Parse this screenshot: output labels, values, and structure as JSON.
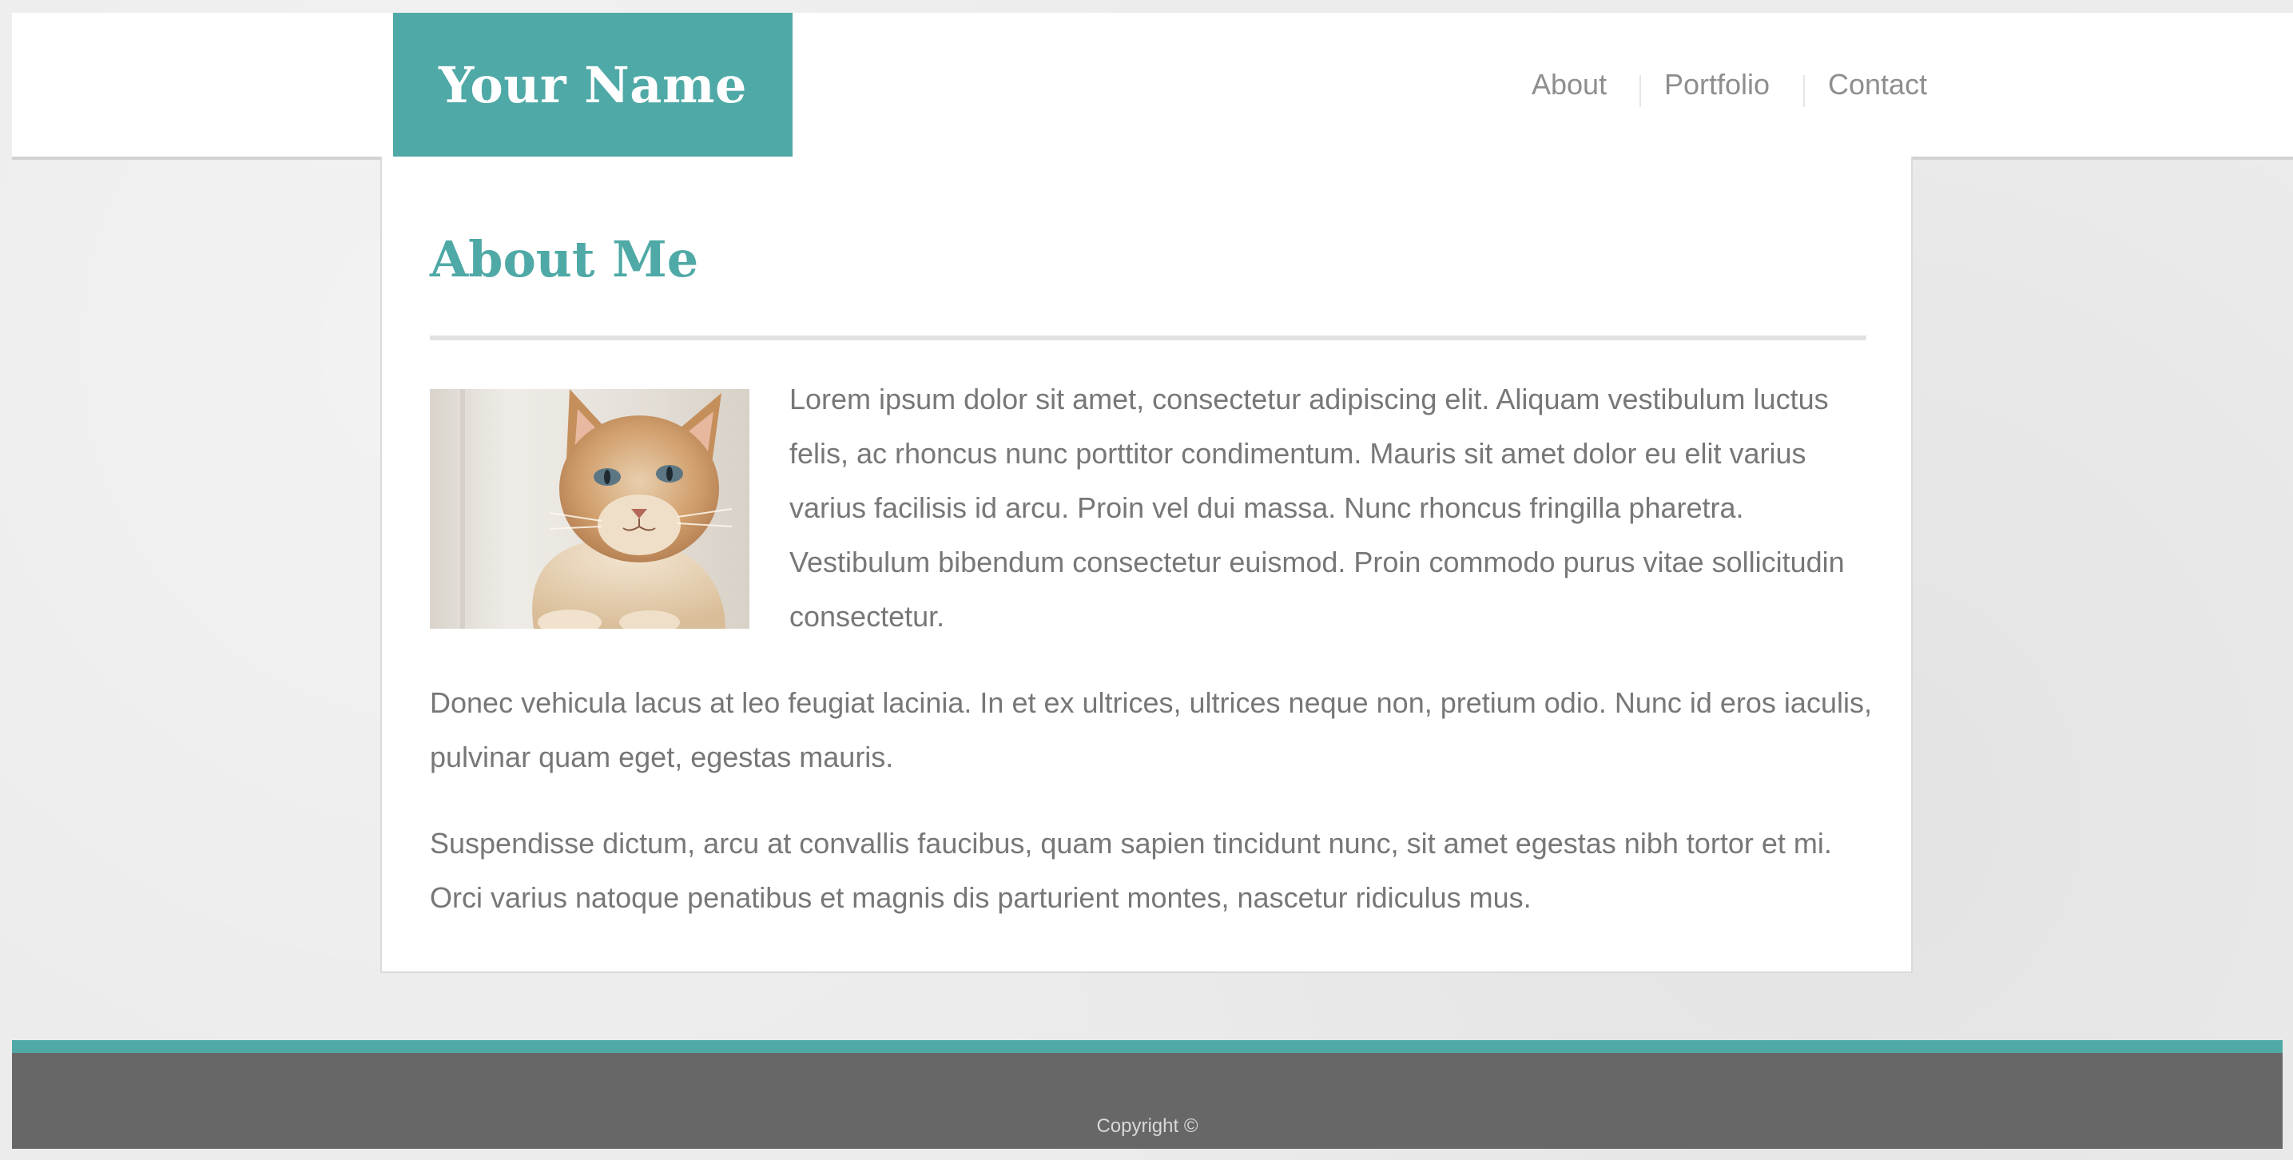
{
  "brand": {
    "name": "Your Name"
  },
  "nav": {
    "items": [
      "About",
      "Portfolio",
      "Contact"
    ]
  },
  "main": {
    "title": "About Me",
    "image": "cat-photo",
    "paragraphs": [
      "Lorem ipsum dolor sit amet, consectetur adipiscing elit. Aliquam vestibulum luctus felis, ac rhoncus nunc porttitor condimentum. Mauris sit amet dolor eu elit varius varius facilisis id arcu. Proin vel dui massa. Nunc rhoncus fringilla pharetra. Vestibulum bibendum consectetur euismod. Proin commodo purus vitae sollicitudin consectetur.",
      "Donec vehicula lacus at leo feugiat lacinia. In et ex ultrices, ultrices neque non, pretium odio. Nunc id eros iaculis, pulvinar quam eget, egestas mauris.",
      "Suspendisse dictum, arcu at convallis faucibus, quam sapien tincidunt nunc, sit amet egestas nibh tortor et mi. Orci varius natoque penatibus et magnis dis parturient montes, nascetur ridiculus mus."
    ]
  },
  "footer": {
    "copyright": "Copyright ©"
  },
  "colors": {
    "accent": "#4fa9a6",
    "footer": "#676767",
    "text": "#777777",
    "nav_text": "#8e8e8e"
  }
}
